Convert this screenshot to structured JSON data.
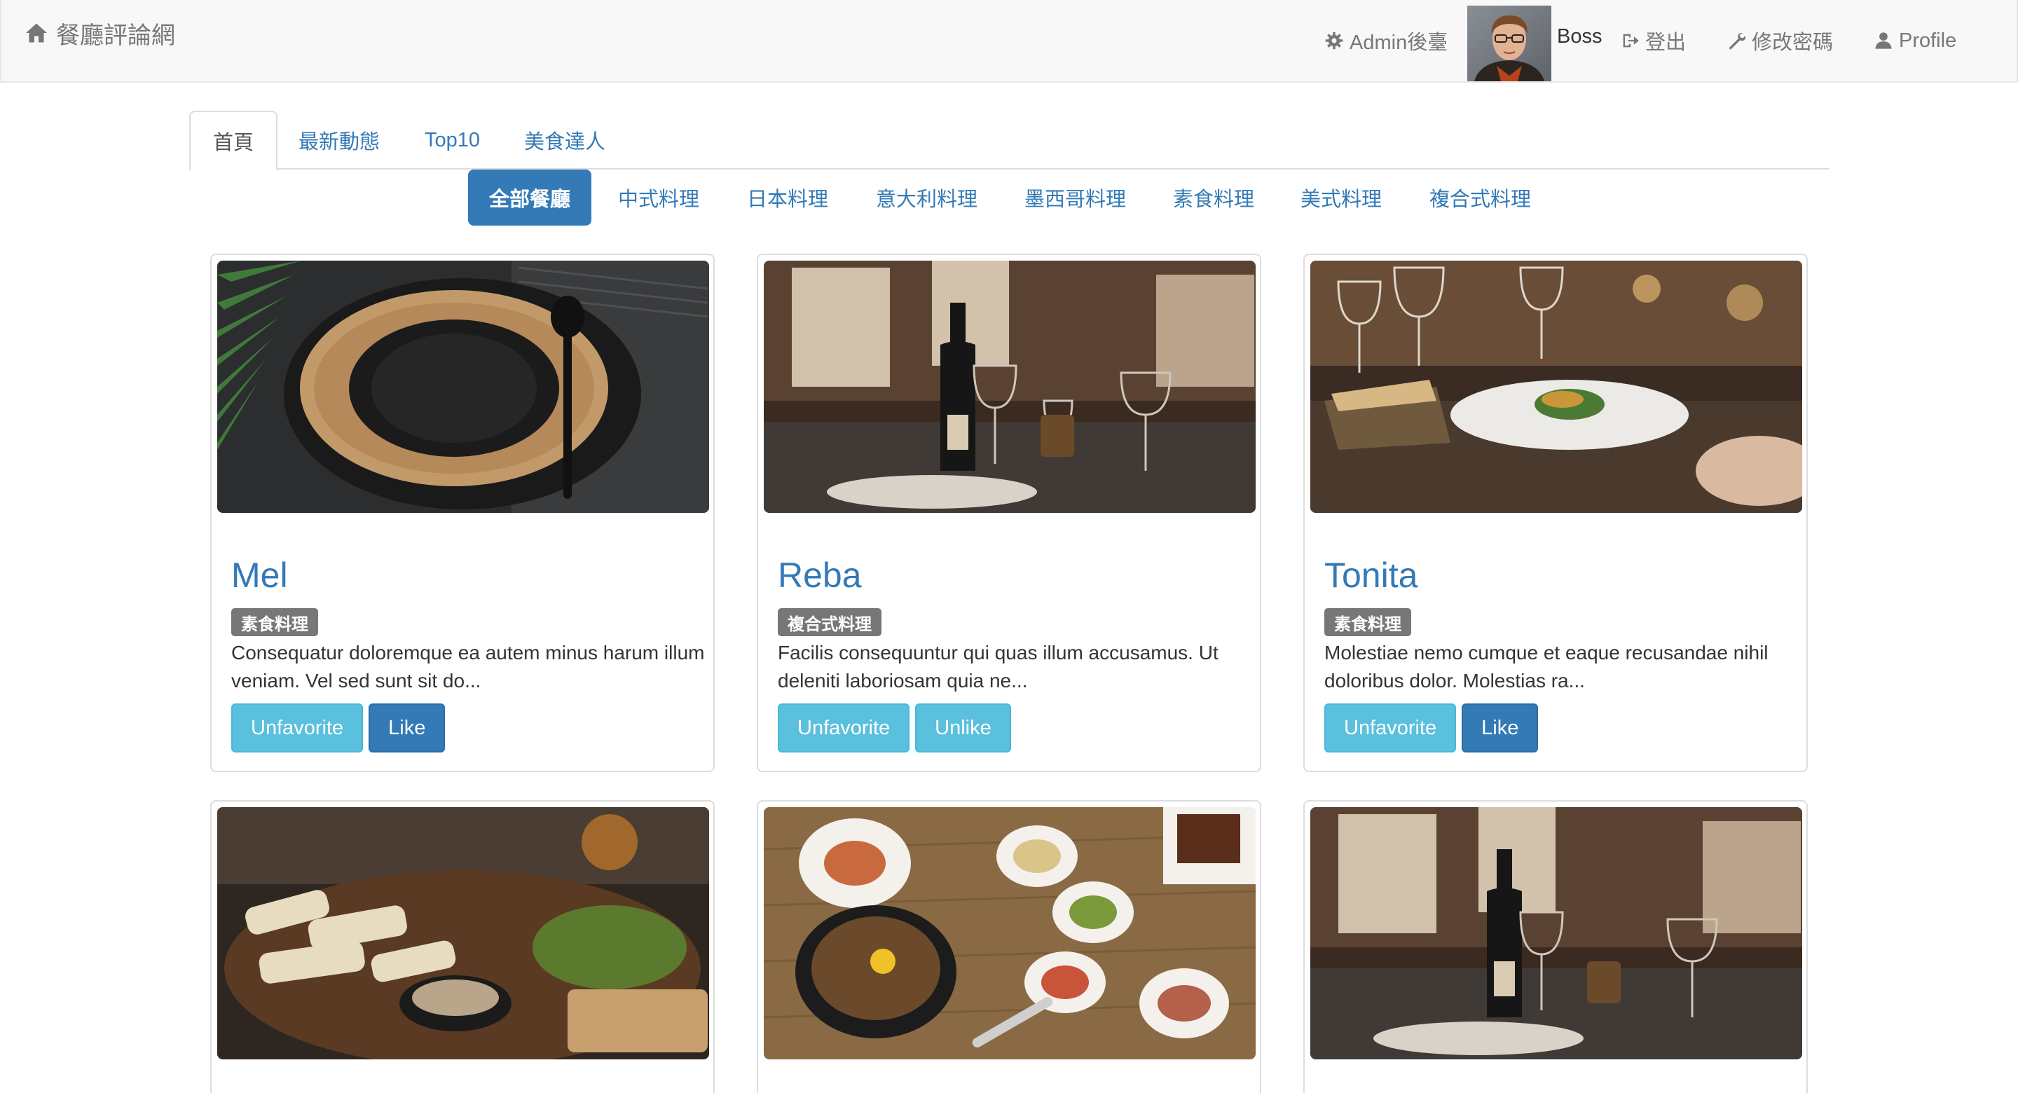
{
  "navbar": {
    "brand_label": "餐廳評論網",
    "admin_label": "Admin後臺",
    "user_name": "Boss",
    "logout_label": "登出",
    "change_password_label": "修改密碼",
    "profile_label": "Profile",
    "icons": [
      "home-icon",
      "gear-icon",
      "logout-icon",
      "wrench-icon",
      "user-icon"
    ]
  },
  "tabs": [
    {
      "label": "首頁",
      "active": true
    },
    {
      "label": "最新動態",
      "active": false
    },
    {
      "label": "Top10",
      "active": false
    },
    {
      "label": "美食達人",
      "active": false
    }
  ],
  "categories": [
    {
      "label": "全部餐廳",
      "active": true
    },
    {
      "label": "中式料理",
      "active": false
    },
    {
      "label": "日本料理",
      "active": false
    },
    {
      "label": "意大利料理",
      "active": false
    },
    {
      "label": "墨西哥料理",
      "active": false
    },
    {
      "label": "素食料理",
      "active": false
    },
    {
      "label": "美式料理",
      "active": false
    },
    {
      "label": "複合式料理",
      "active": false
    }
  ],
  "restaurants": [
    {
      "name": "Mel",
      "category": "素食料理",
      "description": "Consequatur doloremque ea autem minus harum illum veniam. Vel sed sunt sit do...",
      "favorite_button": "Unfavorite",
      "like_button": "Like",
      "like_style": "primary"
    },
    {
      "name": "Reba",
      "category": "複合式料理",
      "description": "Facilis consequuntur qui quas illum accusamus. Ut deleniti laboriosam quia ne...",
      "favorite_button": "Unfavorite",
      "like_button": "Unlike",
      "like_style": "info"
    },
    {
      "name": "Tonita",
      "category": "素食料理",
      "description": "Molestiae nemo cumque et eaque recusandae nihil doloribus dolor. Molestias ra...",
      "favorite_button": "Unfavorite",
      "like_button": "Like",
      "like_style": "primary"
    }
  ],
  "colors": {
    "link": "#337ab7",
    "primary": "#337ab7",
    "info": "#5bc0de",
    "badge": "#777777",
    "navbar_bg": "#f8f8f8"
  }
}
